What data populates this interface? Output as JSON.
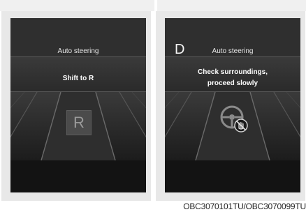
{
  "panel_left": {
    "title": "Auto steering",
    "message": "Shift to R",
    "gear_display": "R"
  },
  "panel_right": {
    "gear_indicator": "D",
    "title": "Auto steering",
    "message_line1": "Check surroundings,",
    "message_line2": "proceed slowly",
    "icon": "steering-wheel-hand-icon"
  },
  "caption": "OBC3070101TU/OBC3070099TU"
}
